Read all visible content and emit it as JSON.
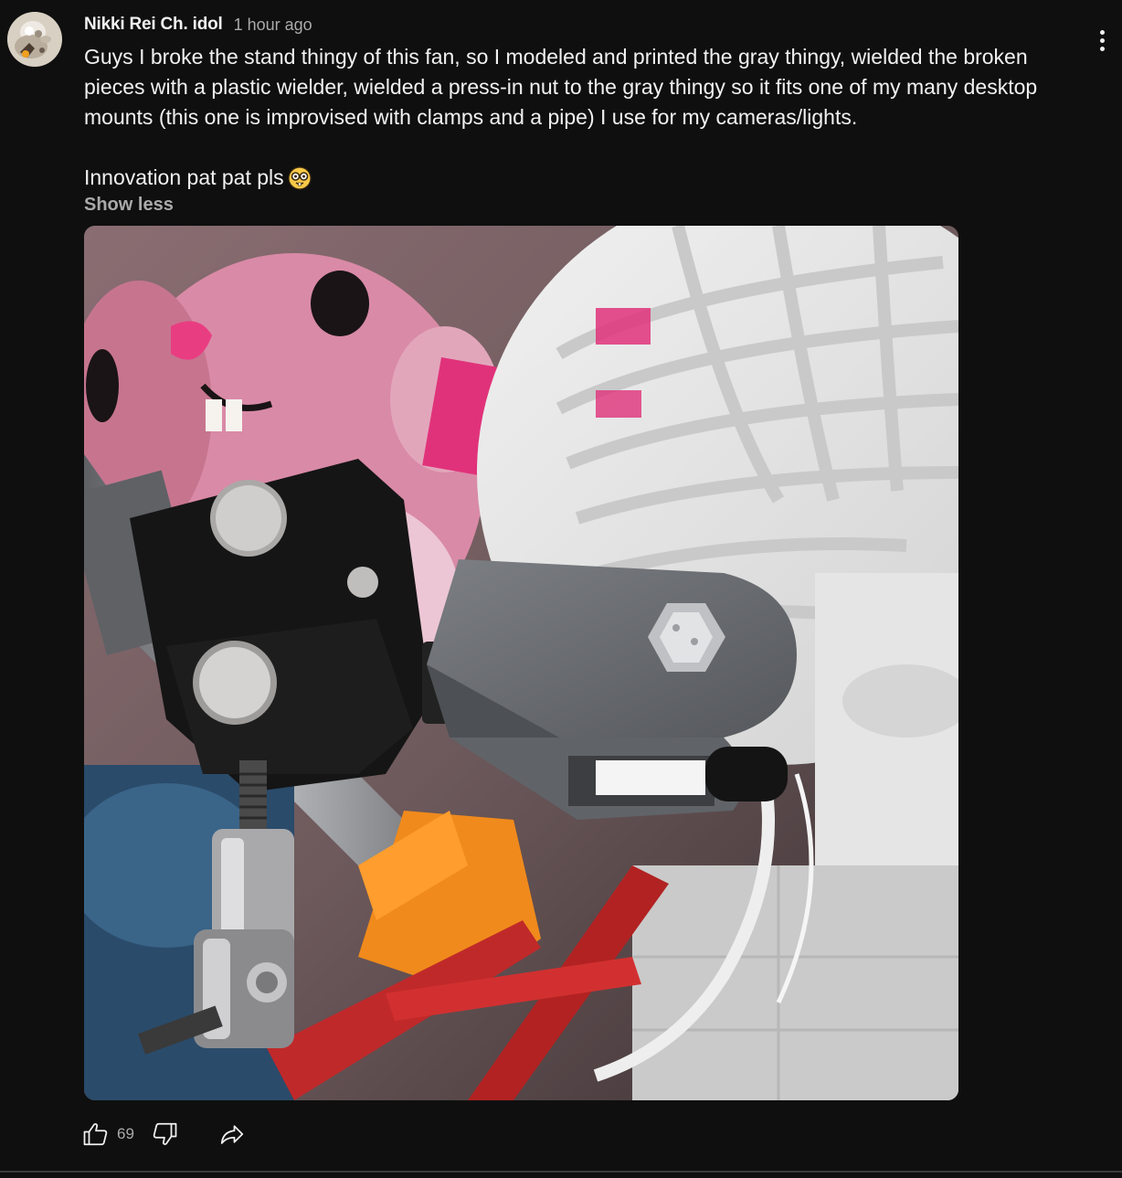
{
  "comment": {
    "author": "Nikki Rei Ch. idol",
    "timestamp": "1 hour ago",
    "body": "Guys I broke the stand thingy of this fan, so I modeled and printed the gray thingy, wielded the broken pieces with a plastic wielder, wielded a press-in nut to the gray thingy so it fits one of my many desktop mounts (this one is improvised with clamps and a pipe) I use for my cameras/lights.",
    "second_line": "Innovation pat pat pls",
    "emoji": "nerd-face-emoji",
    "show_less_label": "Show less",
    "like_count": "69",
    "image_description_icon": "photo-attachment"
  },
  "icons": {
    "menu": "vertical-dots-icon",
    "like": "thumbs-up-icon",
    "dislike": "thumbs-down-icon",
    "share": "share-arrow-icon"
  },
  "colors": {
    "background": "#0f0f0f",
    "text_primary": "#f1f1f1",
    "text_secondary": "#aaaaaa"
  }
}
